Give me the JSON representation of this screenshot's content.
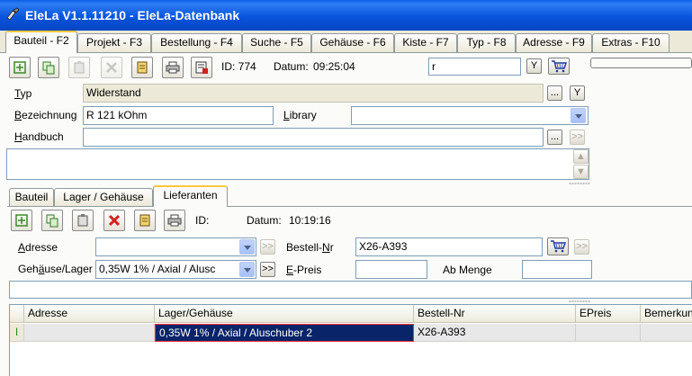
{
  "window": {
    "title": "EleLa V1.1.11210  - EleLa-Datenbank"
  },
  "main_tabs": [
    {
      "label": "Bauteil - F2"
    },
    {
      "label": "Projekt - F3"
    },
    {
      "label": "Bestellung - F4"
    },
    {
      "label": "Suche - F5"
    },
    {
      "label": "Gehäuse - F6"
    },
    {
      "label": "Kiste - F7"
    },
    {
      "label": "Typ - F8"
    },
    {
      "label": "Adresse - F9"
    },
    {
      "label": "Extras - F10"
    }
  ],
  "toolbar": {
    "id_label": "ID: 774",
    "datum_label": "Datum:",
    "datum_value": "09:25:04",
    "search_value": "r",
    "y_button": "Y"
  },
  "bauteil": {
    "typ_label": "Typ",
    "typ_value": "Widerstand",
    "bezeichnung_label": "Bezeichnung",
    "bezeichnung_value": "R 121 kOhm",
    "library_label": "Library",
    "library_value": "",
    "handbuch_label": "Handbuch",
    "handbuch_value": "",
    "ellipsis": "...",
    "goto": ">>",
    "y_button": "Y"
  },
  "sub_tabs": [
    {
      "label": "Bauteil"
    },
    {
      "label": "Lager / Gehäuse"
    },
    {
      "label": "Lieferanten"
    }
  ],
  "lieferanten": {
    "id_label": "ID:",
    "datum_label": "Datum:",
    "datum_value": "10:19:16",
    "adresse_label": "Adresse",
    "adresse_value": "",
    "gehaeuse_label": "Gehäuse/Lager",
    "gehaeuse_value": "0,35W 1% / Axial / Alusc",
    "bestell_nr_label": "Bestell-Nr",
    "bestell_nr_value": "X26-A393",
    "e_preis_label": "E-Preis",
    "e_preis_value": "",
    "ab_menge_label": "Ab Menge",
    "ab_menge_value": "",
    "goto": ">>"
  },
  "grid": {
    "columns": [
      "Adresse",
      "Lager/Gehäuse",
      "Bestell-Nr",
      "EPreis",
      "Bemerkung"
    ],
    "rows": [
      {
        "indicator": "I",
        "adresse": "",
        "lager": "0,35W 1% / Axial / Aluschuber 2",
        "bestell_nr": "X26-A393",
        "epreis": "",
        "bemerkung": ""
      }
    ]
  }
}
